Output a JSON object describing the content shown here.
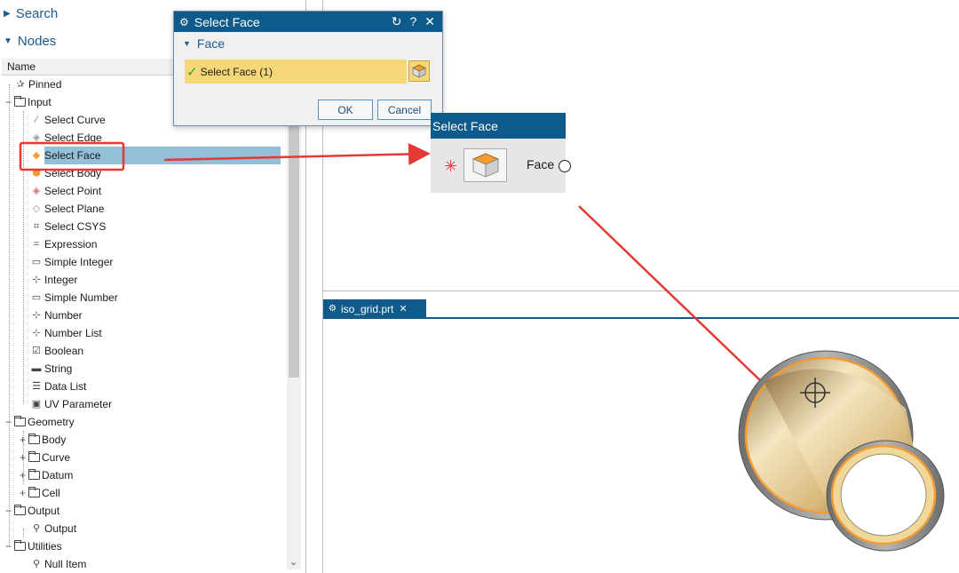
{
  "navigator": {
    "search_label": "Search",
    "nodes_label": "Nodes",
    "column_name": "Name",
    "items": [
      {
        "label": "Pinned"
      },
      {
        "label": "Input"
      },
      {
        "label": "Select Curve"
      },
      {
        "label": "Select Edge"
      },
      {
        "label": "Select Face"
      },
      {
        "label": "Select Body"
      },
      {
        "label": "Select Point"
      },
      {
        "label": "Select Plane"
      },
      {
        "label": "Select CSYS"
      },
      {
        "label": "Expression"
      },
      {
        "label": "Simple Integer"
      },
      {
        "label": "Integer"
      },
      {
        "label": "Simple Number"
      },
      {
        "label": "Number"
      },
      {
        "label": "Number List"
      },
      {
        "label": "Boolean"
      },
      {
        "label": "String"
      },
      {
        "label": "Data List"
      },
      {
        "label": "UV Parameter"
      },
      {
        "label": "Geometry"
      },
      {
        "label": "Body"
      },
      {
        "label": "Curve"
      },
      {
        "label": "Datum"
      },
      {
        "label": "Cell"
      },
      {
        "label": "Output"
      },
      {
        "label": "Output"
      },
      {
        "label": "Utilities"
      },
      {
        "label": "Null Item"
      }
    ],
    "selected_item": "Select Face"
  },
  "dialog": {
    "title": "Select Face",
    "reset_icon": "↻",
    "help_icon": "?",
    "close_icon": "✕",
    "group_label": "Face",
    "selection_label": "Select Face (1)",
    "ok_label": "OK",
    "cancel_label": "Cancel"
  },
  "block": {
    "title": "Select Face",
    "required_marker": "✳",
    "port_label": "Face"
  },
  "graphics_tab": {
    "label": "iso_grid.prt",
    "close_icon": "✕",
    "accent": "#0e5a8a"
  },
  "colors": {
    "title_bar": "#0e5a8a",
    "selection_highlight": "#f6d777",
    "tree_selection": "#93bfd8",
    "annotation_red": "#e53935",
    "part_edge_orange": "#f39c33"
  }
}
